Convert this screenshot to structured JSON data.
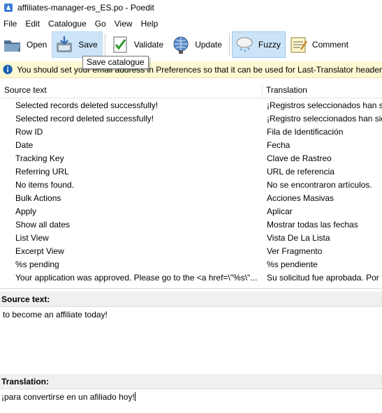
{
  "window": {
    "title": "affiliates-manager-es_ES.po - Poedit"
  },
  "menu": [
    "File",
    "Edit",
    "Catalogue",
    "Go",
    "View",
    "Help"
  ],
  "toolbar": {
    "open": "Open",
    "save": "Save",
    "validate": "Validate",
    "update": "Update",
    "fuzzy": "Fuzzy",
    "comment": "Comment"
  },
  "tooltip": "Save catalogue",
  "infobar": {
    "message": "You should set your email address in Preferences so that it can be used for Last-Translator header"
  },
  "columns": {
    "source": "Source text",
    "translation": "Translation"
  },
  "rows": [
    {
      "source": "Selected records deleted successfully!",
      "translation": "¡Registros seleccionados han sido eliminados"
    },
    {
      "source": "Selected record deleted successfully!",
      "translation": "¡Registro seleccionados han sido eliminados"
    },
    {
      "source": "Row ID",
      "translation": "Fila de Identificación"
    },
    {
      "source": "Date",
      "translation": "Fecha"
    },
    {
      "source": "Tracking Key",
      "translation": "Clave de Rastreo"
    },
    {
      "source": "Referring URL",
      "translation": "URL de referencia"
    },
    {
      "source": "No items found.",
      "translation": "No se encontraron artículos."
    },
    {
      "source": "Bulk Actions",
      "translation": "Acciones Masivas"
    },
    {
      "source": "Apply",
      "translation": "Aplicar"
    },
    {
      "source": "Show all dates",
      "translation": "Mostrar todas las fechas"
    },
    {
      "source": "List View",
      "translation": "Vista De La Lista"
    },
    {
      "source": "Excerpt View",
      "translation": "Ver Fragmento"
    },
    {
      "source": "%s pending",
      "translation": "%s pendiente"
    },
    {
      "source": "Your application was approved.  Please go to the <a href=\\\"%s\\\"...",
      "translation": "Su solicitud fue aprobada. Por favor"
    }
  ],
  "source_pane": {
    "label": "Source text:",
    "text": "to become an affiliate today!"
  },
  "translation_pane": {
    "label": "Translation:",
    "text": "¡para convertirse en un afiliado hoy!"
  },
  "colors": {
    "info_bg": "#fcf9d3",
    "button_hover": "#cce4f7",
    "info_icon": "#1a5fb4"
  }
}
